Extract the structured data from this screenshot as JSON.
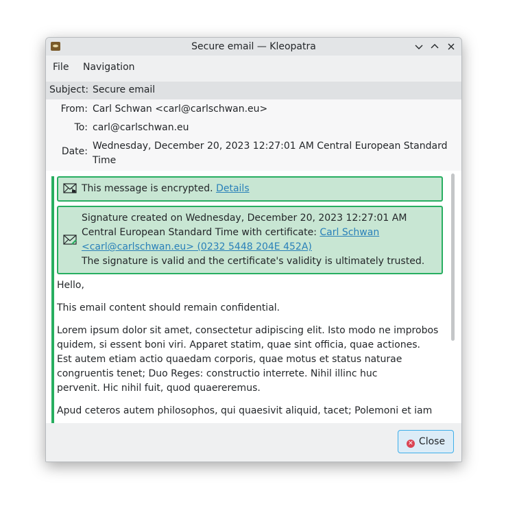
{
  "window": {
    "title": "Secure email — Kleopatra",
    "controls": {
      "minimize": "⌄",
      "maximize": "⌃",
      "close": "✕"
    }
  },
  "menu": {
    "file": "File",
    "navigation": "Navigation"
  },
  "headers": {
    "subject_label": "Subject:",
    "subject_value": "Secure email",
    "from_label": "From:",
    "from_value": "Carl Schwan <carl@carlschwan.eu>",
    "to_label": "To:",
    "to_value": "carl@carlschwan.eu",
    "date_label": "Date:",
    "date_value_line1": "Wednesday, December 20, 2023 12:27:01 AM Central European Standard",
    "date_value_line2": "Time"
  },
  "encryption_banner": {
    "text": "This message is encrypted.",
    "link": "Details"
  },
  "signature_banner": {
    "line1": "Signature created on Wednesday, December 20, 2023 12:27:01 AM",
    "line2_prefix": "Central European Standard Time with certificate:",
    "line2_link": "Carl Schwan",
    "line3_link": "<carl@carlschwan.eu> (0232 5448 204E 452A)",
    "line4": "The signature is valid and the certificate's validity is ultimately trusted."
  },
  "body": {
    "greeting": "Hello,",
    "p1": "This email content should remain confidential.",
    "p2_l1": "Lorem ipsum dolor sit amet, consectetur adipiscing elit. Isto modo ne improbos",
    "p2_l2": "quidem, si essent boni viri. Apparet statim, quae sint officia, quae actiones.",
    "p2_l3": "Est autem etiam actio quaedam corporis, quae motus et status naturae",
    "p2_l4": "congruentis tenet; Duo Reges: constructio interrete. Nihil illinc huc",
    "p2_l5": "pervenit. Hic nihil fuit, quod quaereremus.",
    "p3_l1": "Apud ceteros autem philosophos, qui quaesivit aliquid, tacet; Polemoni et iam"
  },
  "footer": {
    "close_label": "Close"
  },
  "colors": {
    "accent": "#3daee9",
    "valid_green": "#27ae60",
    "banner_bg": "#c8e6d3",
    "link": "#2980b9"
  }
}
